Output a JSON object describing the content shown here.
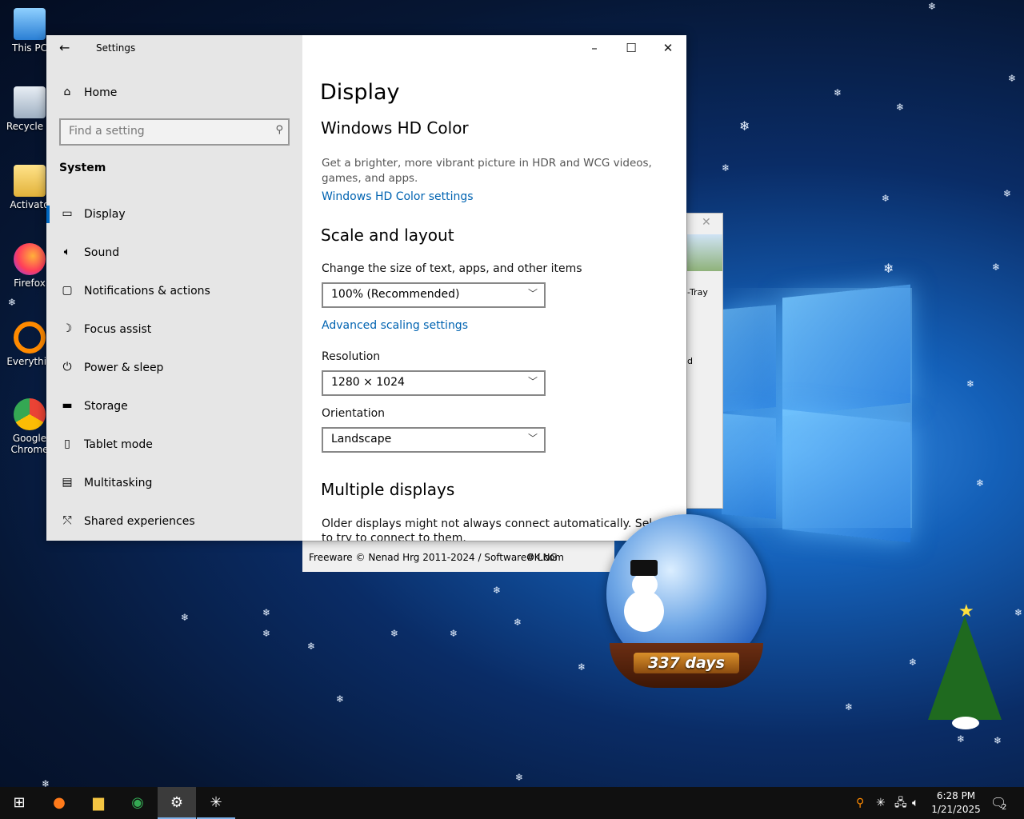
{
  "desktop": {
    "icons": [
      {
        "label": "This PC",
        "icon": "computer-icon"
      },
      {
        "label": "Recycle B",
        "icon": "recycle-bin-icon"
      },
      {
        "label": "Activato",
        "icon": "folder-icon"
      },
      {
        "label": "Firefox",
        "icon": "firefox-icon"
      },
      {
        "label": "Everythin",
        "icon": "search-icon"
      },
      {
        "label": "Google Chrome",
        "icon": "chrome-icon"
      }
    ],
    "background_window_label": "-Tray",
    "background_window_fragment": "d",
    "footer": {
      "copyright": "Freeware © Nenad Hrg 2011-2024 / SoftwareOK.com",
      "lng": "# LNG"
    },
    "globe_text": "337 days"
  },
  "settings": {
    "title": "Settings",
    "home": "Home",
    "search_placeholder": "Find a setting",
    "section": "System",
    "nav": [
      {
        "label": "Display",
        "icon": "monitor-icon",
        "active": true
      },
      {
        "label": "Sound",
        "icon": "speaker-icon"
      },
      {
        "label": "Notifications & actions",
        "icon": "notification-icon"
      },
      {
        "label": "Focus assist",
        "icon": "moon-icon"
      },
      {
        "label": "Power & sleep",
        "icon": "power-icon"
      },
      {
        "label": "Storage",
        "icon": "storage-icon"
      },
      {
        "label": "Tablet mode",
        "icon": "tablet-icon"
      },
      {
        "label": "Multitasking",
        "icon": "multitasking-icon"
      },
      {
        "label": "Shared experiences",
        "icon": "share-icon"
      }
    ],
    "page": {
      "title": "Display",
      "hd_color": {
        "heading": "Windows HD Color",
        "description": "Get a brighter, more vibrant picture in HDR and WCG videos, games, and apps.",
        "link": "Windows HD Color settings"
      },
      "scale": {
        "heading": "Scale and layout",
        "size_label": "Change the size of text, apps, and other items",
        "size_value": "100% (Recommended)",
        "advanced_link": "Advanced scaling settings",
        "resolution_label": "Resolution",
        "resolution_value": "1280 × 1024",
        "orientation_label": "Orientation",
        "orientation_value": "Landscape"
      },
      "multiple": {
        "heading": "Multiple displays",
        "text": "Older displays might not always connect automatically. Select Dete",
        "text2": "to try to connect to them."
      }
    }
  },
  "taskbar": {
    "clock_time": "6:28 PM",
    "clock_date": "1/21/2025",
    "notification_count": "2"
  },
  "colors": {
    "accent": "#0067c0",
    "link": "#0063b1",
    "taskbar": "#101010"
  }
}
